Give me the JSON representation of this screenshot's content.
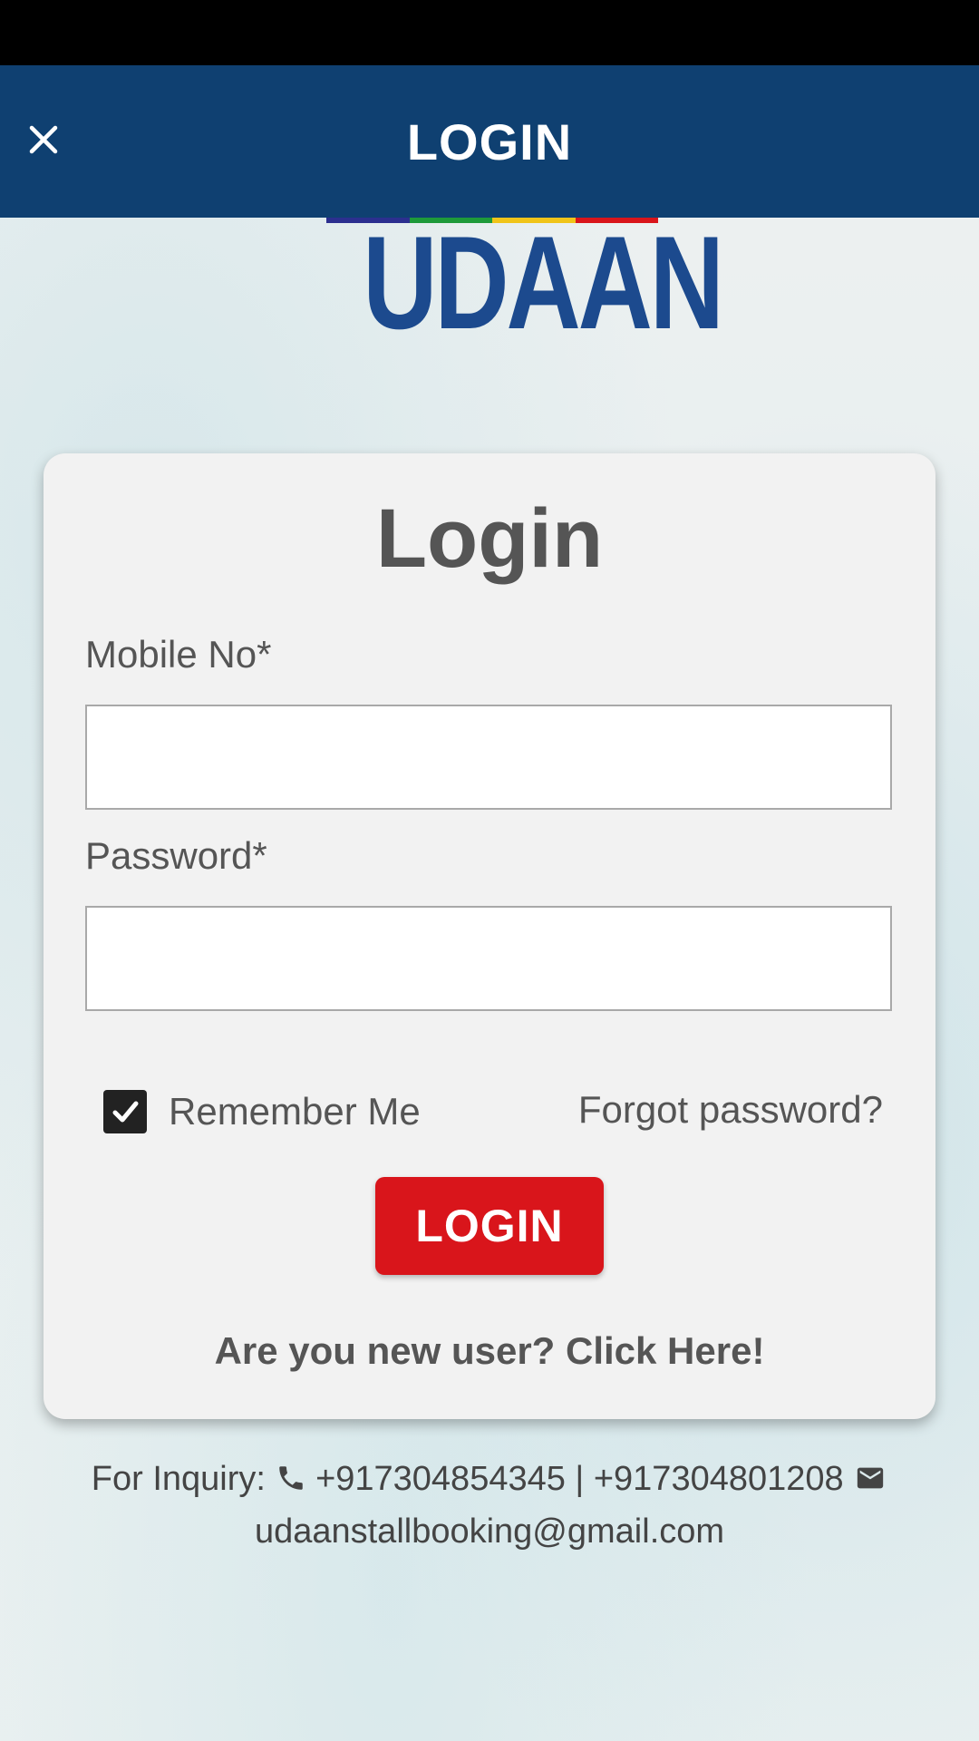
{
  "app_bar": {
    "title": "LOGIN",
    "close_icon": "close-icon",
    "background": "#0f4071"
  },
  "logo": {
    "text": "UDAAN",
    "stripe_colors": [
      "#2c2f8f",
      "#1e9a3a",
      "#f0c419",
      "#d9151b"
    ]
  },
  "form": {
    "title": "Login",
    "mobile_label": "Mobile No*",
    "mobile_value": "",
    "password_label": "Password*",
    "password_value": "",
    "remember_label": "Remember Me",
    "remember_checked": true,
    "forgot_label": "Forgot password?",
    "login_button": "LOGIN",
    "new_user_link": "Are you new user? Click Here!"
  },
  "footer": {
    "inquiry_label": "For Inquiry:",
    "phone_icon": "phone-icon",
    "phones": "+917304854345 | +917304801208",
    "email_icon": "email-icon",
    "email": "udaanstallbooking@gmail.com"
  },
  "colors": {
    "primary": "#0f4071",
    "accent": "#d9151b",
    "text": "#555555"
  }
}
